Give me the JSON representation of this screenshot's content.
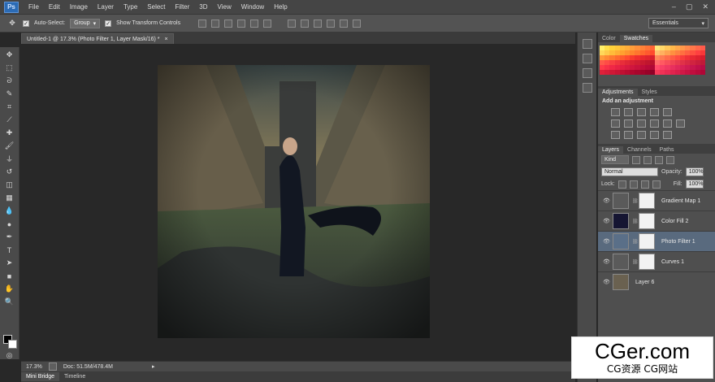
{
  "app": {
    "logo_text": "Ps"
  },
  "menu": {
    "items": [
      "File",
      "Edit",
      "Image",
      "Layer",
      "Type",
      "Select",
      "Filter",
      "3D",
      "View",
      "Window",
      "Help"
    ]
  },
  "window_controls": [
    "–",
    "▢",
    "✕"
  ],
  "options_bar": {
    "auto_select_label": "Auto-Select:",
    "auto_select_value": "Group",
    "transform_label": "Show Transform Controls",
    "workspace": "Essentials"
  },
  "document": {
    "tab_title": "Untitled-1 @ 17.3% (Photo Filter 1, Layer Mask/16) *",
    "close": "×"
  },
  "status": {
    "zoom": "17.3%",
    "doc_size": "Doc: 51.5M/478.4M"
  },
  "bottom_tabs": [
    "Mini Bridge",
    "Timeline"
  ],
  "panels": {
    "color_tabs": [
      "Color",
      "Swatches"
    ],
    "adjust_tabs": [
      "Adjustments",
      "Styles"
    ],
    "add_adjustment": "Add an adjustment",
    "layer_tabs": [
      "Layers",
      "Channels",
      "Paths"
    ],
    "kind_label": "Kind",
    "blend_mode": "Normal",
    "opacity_label": "Opacity:",
    "opacity_value": "100%",
    "lock_label": "Lock:",
    "fill_label": "Fill:",
    "fill_value": "100%"
  },
  "layers": [
    {
      "name": "Gradient Map 1",
      "thumb": "#5a5a5a",
      "selected": false
    },
    {
      "name": "Color Fill 2",
      "thumb": "#151532",
      "selected": false
    },
    {
      "name": "Photo Filter 1",
      "thumb": "#5a6f88",
      "selected": true
    },
    {
      "name": "Curves 1",
      "thumb": "#5a5a5a",
      "selected": false
    },
    {
      "name": "Layer 6",
      "thumb": "#6a6150",
      "selected": false
    }
  ],
  "watermark": {
    "main": "CGer.com",
    "sub": "CG资源  CG网站"
  }
}
